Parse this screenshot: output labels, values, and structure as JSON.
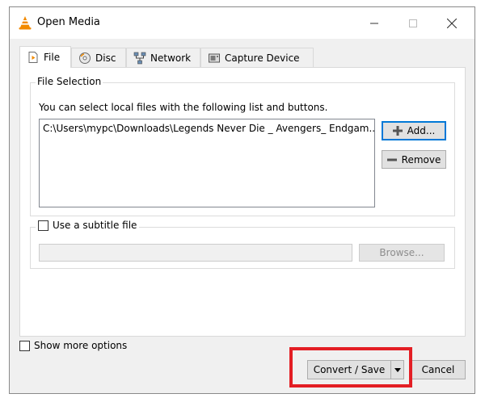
{
  "window": {
    "title": "Open Media",
    "icon": "vlc-cone-icon",
    "controls": {
      "minimize": "—",
      "maximize": "☐",
      "close": "✕"
    }
  },
  "tabs": [
    {
      "label": "File",
      "icon": "file-icon",
      "active": true
    },
    {
      "label": "Disc",
      "icon": "disc-icon",
      "active": false
    },
    {
      "label": "Network",
      "icon": "network-icon",
      "active": false
    },
    {
      "label": "Capture Device",
      "icon": "capture-device-icon",
      "active": false
    }
  ],
  "file_selection": {
    "group_label": "File Selection",
    "hint": "You can select local files with the following list and buttons.",
    "files": [
      "C:\\Users\\mypc\\Downloads\\Legends Never Die _ Avengers_ Endgam..."
    ],
    "add_label": "Add...",
    "remove_label": "Remove"
  },
  "subtitle": {
    "checkbox_label": "Use a subtitle file",
    "checked": false,
    "path_value": "",
    "browse_label": "Browse..."
  },
  "footer": {
    "show_more_label": "Show more options",
    "show_more_checked": false,
    "convert_label": "Convert / Save",
    "cancel_label": "Cancel"
  },
  "colors": {
    "accent": "#0078d7",
    "highlight": "#e31e24",
    "vlc_orange": "#f28a00"
  }
}
